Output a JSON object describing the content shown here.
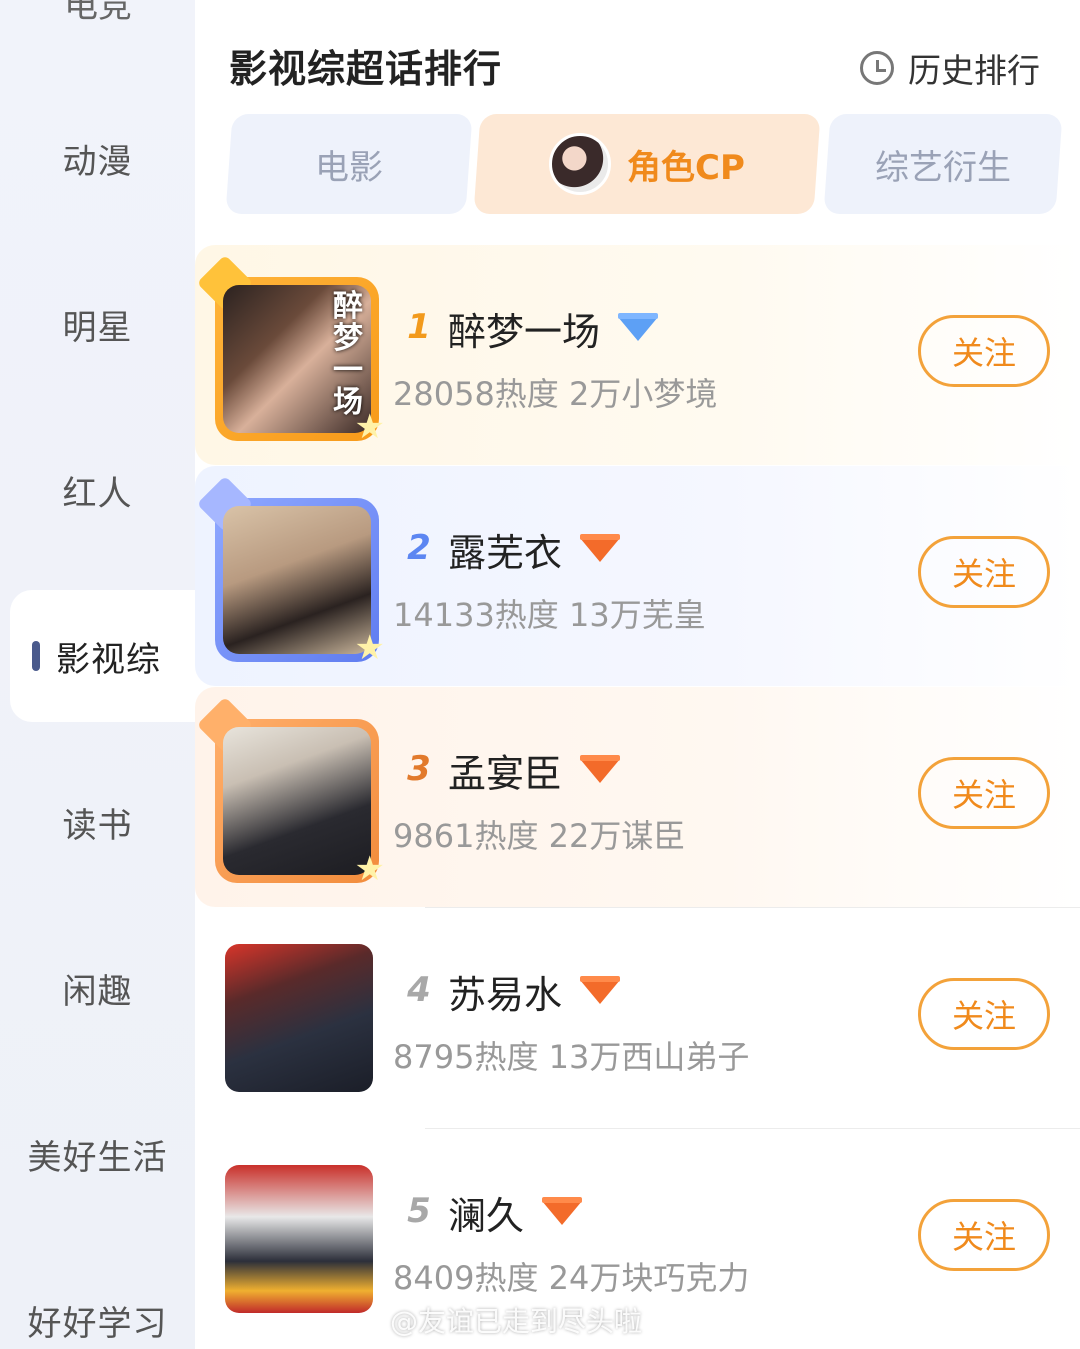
{
  "sidebar": {
    "cut_label": "电竞",
    "items": [
      {
        "label": "动漫"
      },
      {
        "label": "明星"
      },
      {
        "label": "红人"
      },
      {
        "label": "影视综"
      },
      {
        "label": "读书"
      },
      {
        "label": "闲趣"
      },
      {
        "label": "美好生活"
      },
      {
        "label": "好好学习"
      }
    ],
    "active_index": 3
  },
  "header": {
    "title": "影视综超话排行",
    "history_label": "历史排行"
  },
  "tabs": [
    {
      "label": "电影"
    },
    {
      "label": "角色CP"
    },
    {
      "label": "综艺衍生"
    }
  ],
  "ranking": [
    {
      "rank": "1",
      "name": "醉梦一场",
      "meta": "28058热度 2万小梦境",
      "follow": "关注",
      "poster_text": "醉梦一场"
    },
    {
      "rank": "2",
      "name": "露芜衣",
      "meta": "14133热度 13万芜皇",
      "follow": "关注"
    },
    {
      "rank": "3",
      "name": "孟宴臣",
      "meta": "9861热度 22万谋臣",
      "follow": "关注"
    },
    {
      "rank": "4",
      "name": "苏易水",
      "meta": "8795热度 13万西山弟子",
      "follow": "关注"
    },
    {
      "rank": "5",
      "name": "澜久",
      "meta": "8409热度 24万块巧克力",
      "follow": "关注"
    }
  ],
  "watermark": "@友谊已走到尽头啦",
  "colors": {
    "accent": "#f08a1c",
    "gold": "#f29a1c",
    "silver_blue": "#5c86f2",
    "bronze": "#e27a2c"
  }
}
